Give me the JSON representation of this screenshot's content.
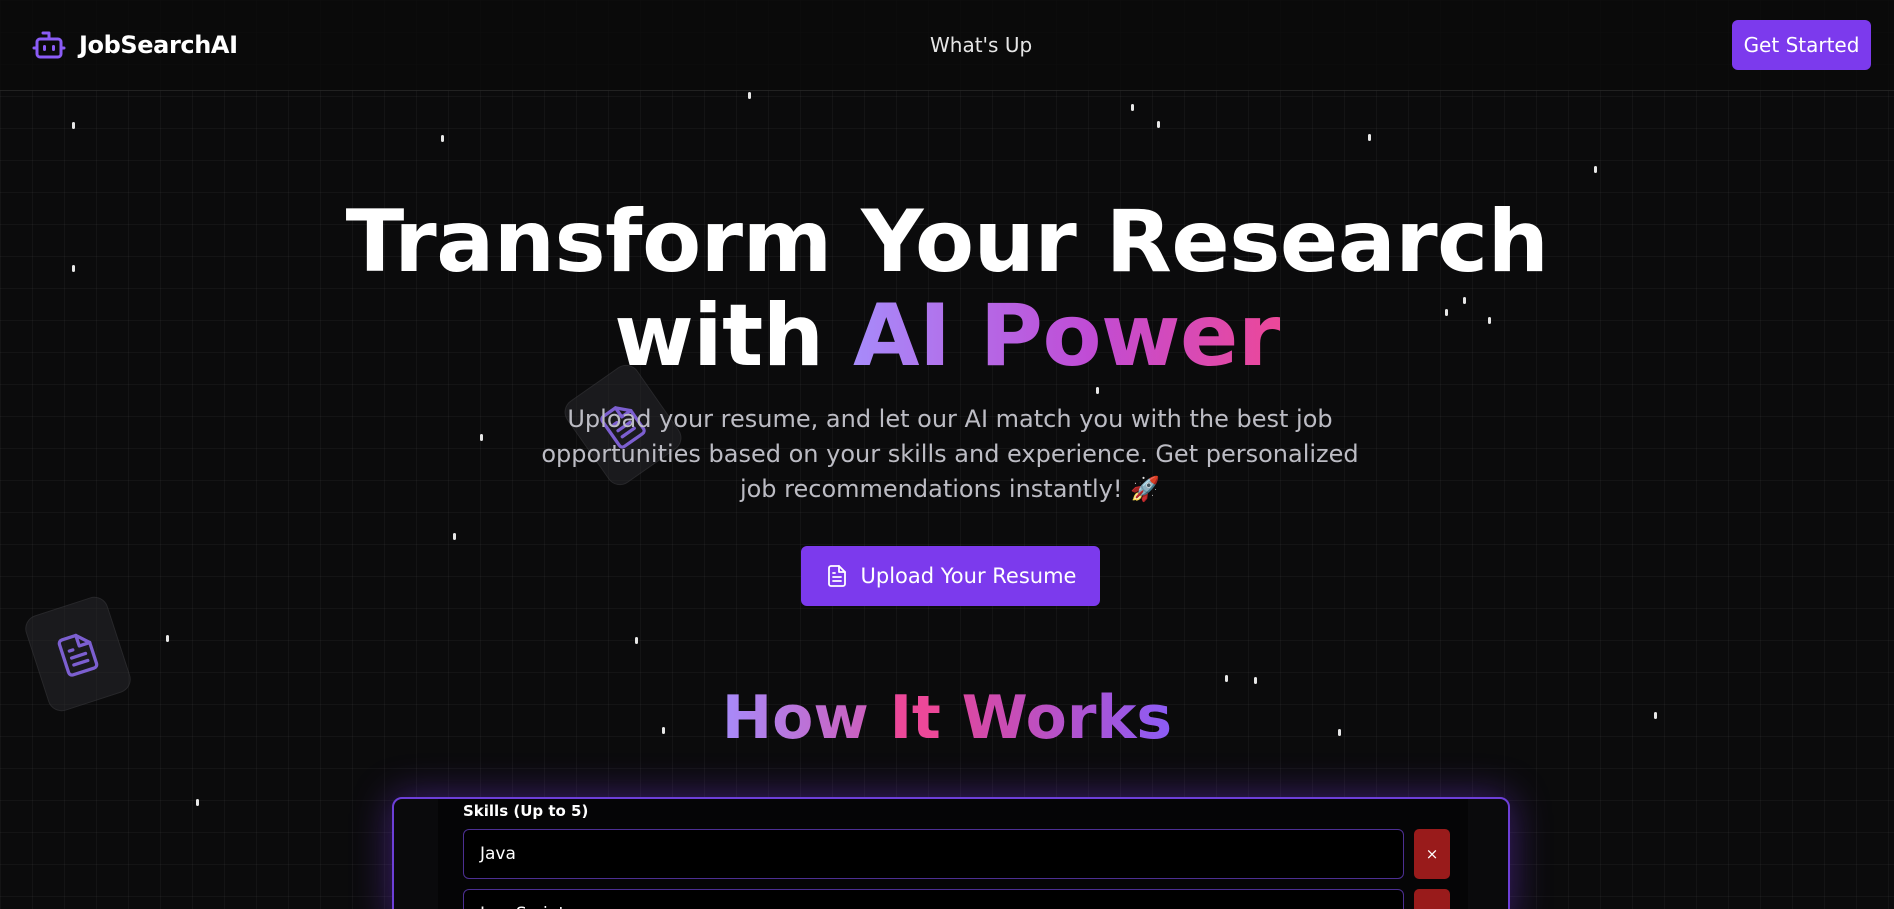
{
  "nav": {
    "brand": "JobSearchAI",
    "brand_icon": "robot-icon",
    "link": "What's Up",
    "cta": "Get Started"
  },
  "hero": {
    "title_line1": "Transform Your Research",
    "title_with": "with ",
    "title_highlight": "AI Power",
    "subtitle": "Upload your resume, and let our AI match you with the best job opportunities based on your skills and experience. Get personalized job recommendations instantly! 🚀",
    "upload_button": "Upload Your Resume",
    "upload_icon": "document-icon"
  },
  "how": {
    "title_a": "How ",
    "title_b": "It ",
    "title_c": "Works"
  },
  "demo": {
    "skills_label": "Skills (Up to 5)",
    "skills": [
      {
        "value": "Java",
        "remove": "×"
      },
      {
        "value": "JavaScript",
        "remove": "×"
      }
    ]
  },
  "colors": {
    "accent": "#7c3aed",
    "background": "#0b0b0c",
    "danger": "#991b1b"
  }
}
